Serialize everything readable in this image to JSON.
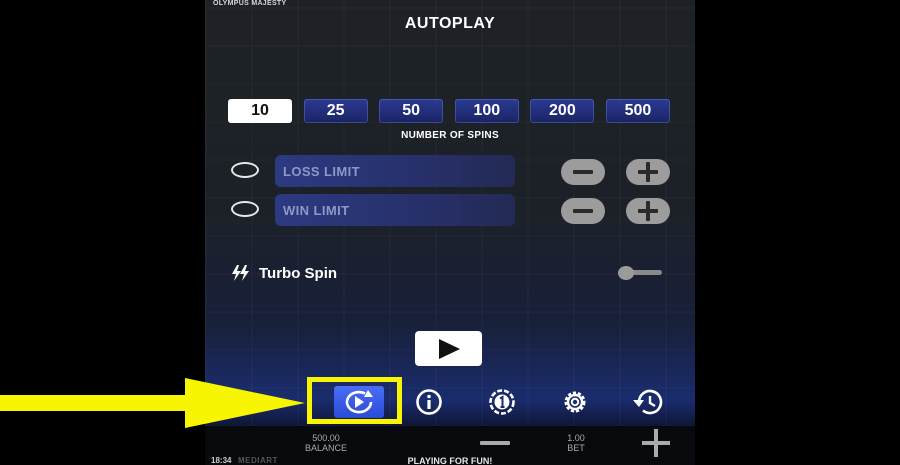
{
  "game": {
    "name": "OLYMPUS MAJESTY"
  },
  "dialog": {
    "title": "AUTOPLAY"
  },
  "spins": {
    "options": [
      "10",
      "25",
      "50",
      "100",
      "200",
      "500"
    ],
    "selected": "10",
    "label": "NUMBER OF SPINS"
  },
  "limits": {
    "loss": {
      "label": "LOSS LIMIT",
      "checked": false
    },
    "win": {
      "label": "WIN LIMIT",
      "checked": false
    }
  },
  "turbo": {
    "label": "Turbo Spin",
    "enabled": false
  },
  "play": {
    "icon": "play-icon"
  },
  "nav": {
    "icons": [
      "menu-dots-icon",
      "autoplay-icon",
      "info-icon",
      "coin-one-icon",
      "settings-gear-icon",
      "history-icon"
    ],
    "active": "autoplay-icon"
  },
  "footer": {
    "balance_value": "500.00",
    "balance_label": "BALANCE",
    "bet_value": "1.00",
    "bet_label": "BET",
    "time": "18:34",
    "brand": "MEDIART",
    "status": "PLAYING FOR FUN!"
  },
  "annotation": {
    "highlight_color": "#f7f500",
    "target": "autoplay-button"
  },
  "colors": {
    "accent": "#2b4ad8",
    "panel": "#27306a",
    "background": "#1c2128"
  }
}
